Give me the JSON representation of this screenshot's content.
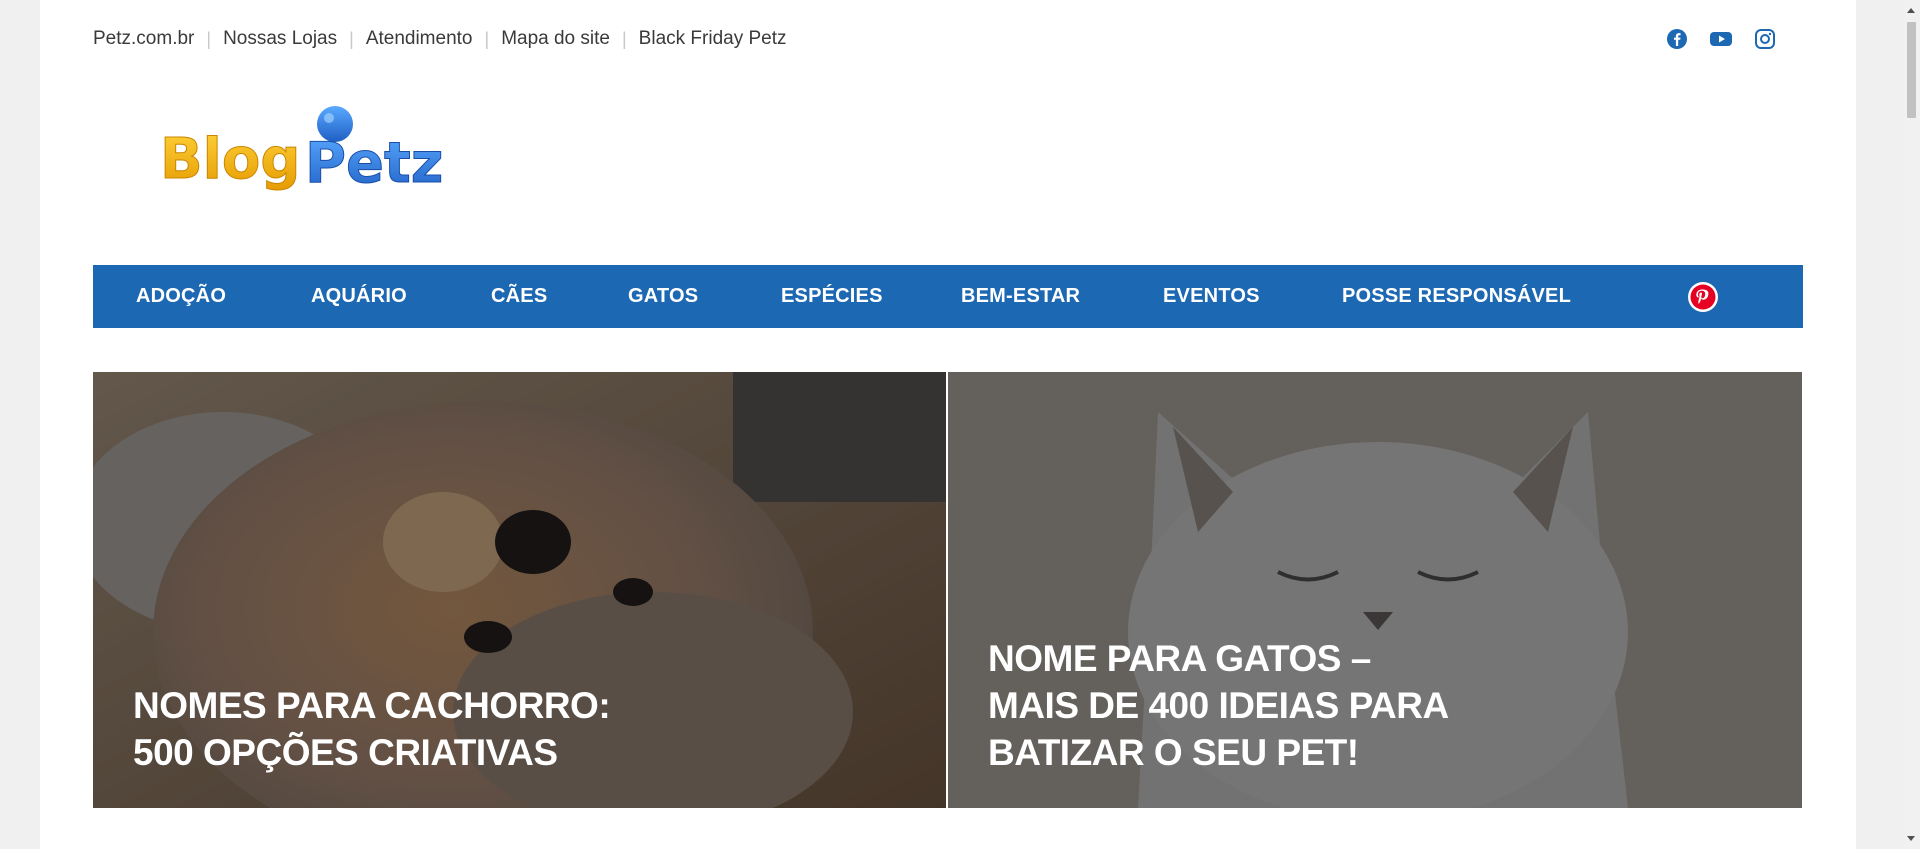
{
  "topbar": {
    "links": [
      "Petz.com.br",
      "Nossas Lojas",
      "Atendimento",
      "Mapa do site",
      "Black Friday Petz"
    ],
    "separator": "|"
  },
  "social": {
    "icons": [
      "facebook-icon",
      "youtube-icon",
      "instagram-icon"
    ],
    "color": "#1d68b3"
  },
  "logo": {
    "text_part1": "Blog",
    "text_part2": "Petz",
    "colors": [
      "#f5b400",
      "#2f7fd8"
    ]
  },
  "nav": {
    "background": "#1d68b3",
    "items": [
      "ADOÇÃO",
      "AQUÁRIO",
      "CÃES",
      "GATOS",
      "ESPÉCIES",
      "BEM-ESTAR",
      "EVENTOS",
      "POSSE RESPONSÁVEL"
    ],
    "pinterest_icon": "pinterest-icon"
  },
  "hero": {
    "left_title": "NOMES PARA CACHORRO:\n500 OPÇÕES CRIATIVAS",
    "right_title": "NOME PARA GATOS –\nMAIS DE 400 IDEIAS PARA\nBATIZAR O SEU PET!"
  }
}
